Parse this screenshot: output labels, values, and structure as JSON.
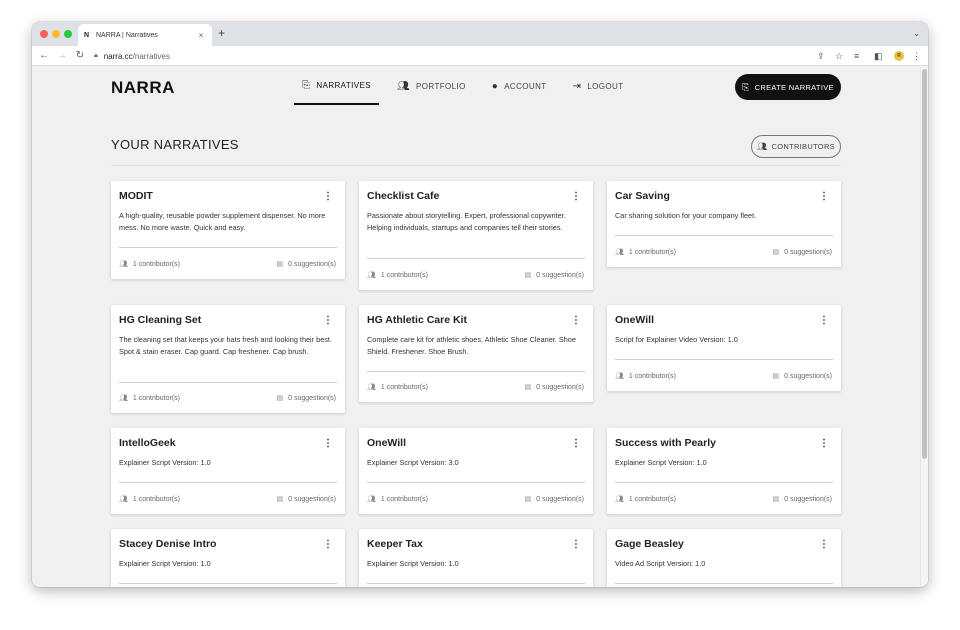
{
  "browser": {
    "tab_favicon": "N",
    "tab_title": "NARRA | Narratives",
    "tab_close": "×",
    "new_tab": "+",
    "url_host": "narra.cc",
    "url_path": "/narratives",
    "profile_initial": "R",
    "icons": [
      "back-arrow-icon",
      "forward-arrow-icon",
      "reload-icon",
      "lock-icon",
      "share-icon",
      "bookmark-star-icon",
      "reading-list-icon",
      "side-panel-icon",
      "kebab-menu-icon"
    ]
  },
  "header": {
    "logo": "NARRA",
    "nav": [
      {
        "label": "NARRATIVES",
        "icon": "narrative-icon",
        "active": true
      },
      {
        "label": "PORTFOLIO",
        "icon": "people-icon",
        "active": false
      },
      {
        "label": "ACCOUNT",
        "icon": "account-circle-icon",
        "active": false
      },
      {
        "label": "LOGOUT",
        "icon": "logout-icon",
        "active": false
      }
    ],
    "create_label": "CREATE NARRATIVE"
  },
  "main": {
    "title": "YOUR NARRATIVES",
    "contributors_label": "CONTRIBUTORS",
    "cards": [
      {
        "title": "MODIT",
        "description": "A high-quality, reusable powder supplement dispenser. No more mess. No more waste. Quick and easy.",
        "contributors": "1 contributor(s)",
        "suggestions": "0 suggestion(s)"
      },
      {
        "title": "Checklist Cafe",
        "description": "Passionate about storytelling. Expert, professional copywriter. Helping individuals, startups and companies tell their stories.",
        "contributors": "1 contributor(s)",
        "suggestions": "0 suggestion(s)"
      },
      {
        "title": "Car Saving",
        "description": "Car sharing solution for your company fleet.",
        "contributors": "1 contributor(s)",
        "suggestions": "0 suggestion(s)"
      },
      {
        "title": "HG Cleaning Set",
        "description": "The cleaning set that keeps your hats fresh and looking their best. Spot & stain eraser. Cap guard. Cap freshener. Cap brush.",
        "contributors": "1 contributor(s)",
        "suggestions": "0 suggestion(s)"
      },
      {
        "title": "HG Athletic Care Kit",
        "description": "Complete care kit for athletic shoes. Athletic Shoe Cleaner. Shoe Shield. Freshener. Shoe Brush.",
        "contributors": "1 contributor(s)",
        "suggestions": "0 suggestion(s)"
      },
      {
        "title": "OneWill",
        "description": "Script for Explainer Video Version: 1.0",
        "contributors": "1 contributor(s)",
        "suggestions": "0 suggestion(s)"
      },
      {
        "title": "IntelloGeek",
        "description": "Explainer Script Version: 1.0",
        "contributors": "1 contributor(s)",
        "suggestions": "0 suggestion(s)"
      },
      {
        "title": "OneWill",
        "description": "Explainer Script Version: 3.0",
        "contributors": "1 contributor(s)",
        "suggestions": "0 suggestion(s)"
      },
      {
        "title": "Success with Pearly",
        "description": "Explainer Script Version: 1.0",
        "contributors": "1 contributor(s)",
        "suggestions": "0 suggestion(s)"
      },
      {
        "title": "Stacey Denise Intro",
        "description": "Explainer Script Version: 1.0",
        "contributors": "",
        "suggestions": ""
      },
      {
        "title": "Keeper Tax",
        "description": "Explainer Script Version: 1.0",
        "contributors": "",
        "suggestions": ""
      },
      {
        "title": "Gage Beasley",
        "description": "Video Ad Script Version: 1.0",
        "contributors": "",
        "suggestions": ""
      }
    ]
  }
}
